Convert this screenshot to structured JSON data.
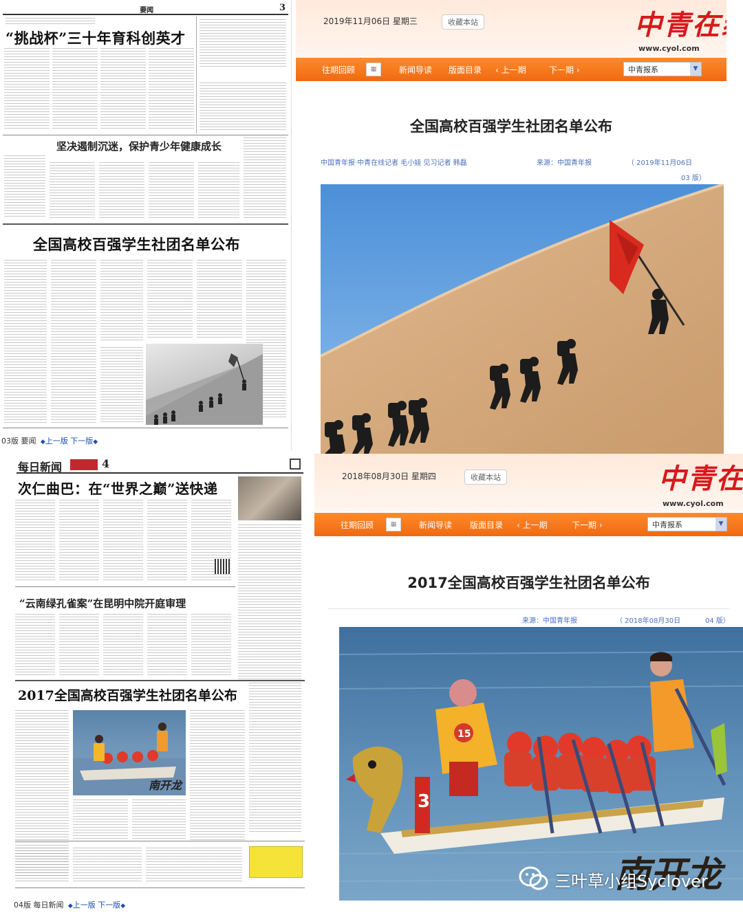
{
  "newspaper_1": {
    "header_section": "要闻",
    "header_page_number": "3",
    "headline_top": "“挑战杯”三十年育科创英才",
    "headline_sub": "坚决遏制沉迷，保护青少年健康成长",
    "headline_main": "全国高校百强学生社团名单公布",
    "footer_page": "03版 要闻",
    "footer_prev": "上一版",
    "footer_next": "下一版"
  },
  "website_1": {
    "date": "2019年11月06日 星期三",
    "favorite_button": "收藏本站",
    "logo_text": "中青在线",
    "logo_url": "www.cyol.com",
    "nav": {
      "history": "往期回顾",
      "news": "新闻导读",
      "toc": "版面目录",
      "prev_issue": "上一期",
      "next_issue": "下一期",
      "select_value": "中青报系"
    },
    "title": "全国高校百强学生社团名单公布",
    "byline": "中国青年报·中青在线记者 毛小娃 见习记者 韩磊",
    "source": "来源：中国青年报",
    "date_line": "（ 2019年11月06日",
    "page_line": "03 版）"
  },
  "newspaper_2": {
    "masthead": "每日新闻",
    "page_number": "4",
    "headline_top": "次仁曲巴：在“世界之巅”送快递",
    "headline_sub": "“云南绿孔雀案”在昆明中院开庭审理",
    "headline_main": "2017全国高校百强学生社团名单公布",
    "photo_caption": "南开龙",
    "footer_page": "04版 每日新闻",
    "footer_prev": "上一版",
    "footer_next": "下一版"
  },
  "website_2": {
    "date": "2018年08月30日 星期四",
    "favorite_button": "收藏本站",
    "logo_text": "中青在线",
    "logo_url": "www.cyol.com",
    "nav": {
      "history": "往期回顾",
      "news": "新闻导读",
      "toc": "版面目录",
      "prev_issue": "上一期",
      "next_issue": "下一期",
      "select_value": "中青报系"
    },
    "title": "2017全国高校百强学生社团名单公布",
    "source": "来源：中国青年报",
    "date_line": "（ 2018年08月30日",
    "page_line": "04 版）",
    "photo_caption": "南开龙",
    "boat_number": "15",
    "bow_number": "3"
  },
  "watermark": {
    "text": "三叶草小组Syclover",
    "icon": "wechat-icon"
  },
  "colors": {
    "nav_orange": "#ef6a12",
    "logo_red": "#d7191c",
    "byline_blue": "#4a6fbe"
  }
}
